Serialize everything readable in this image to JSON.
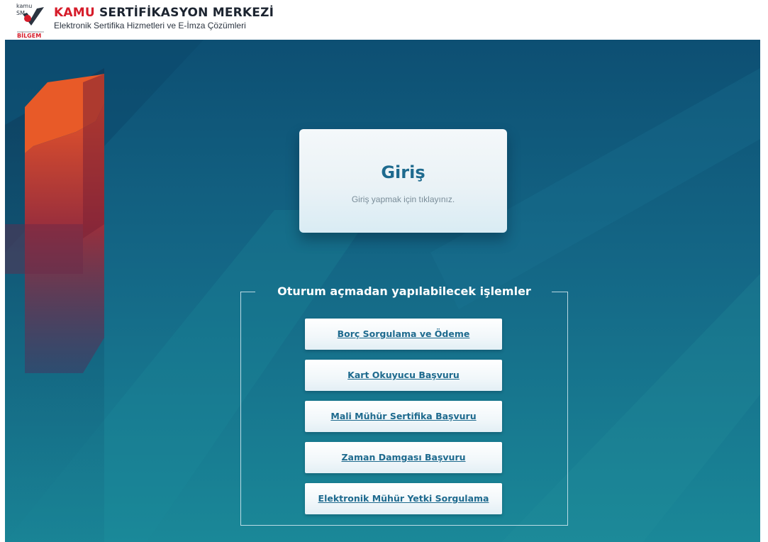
{
  "header": {
    "logo_text_top": "kamu",
    "logo_text_mid": "SM",
    "logo_text_bottom": "BİLGEM",
    "title_red": "KAMU",
    "title_dark": "SERTİFİKASYON MERKEZİ",
    "subtitle": "Elektronik Sertifika Hizmetleri ve E-İmza Çözümleri"
  },
  "login": {
    "title": "Giriş",
    "subtitle": "Giriş yapmak için tıklayınız."
  },
  "operations": {
    "heading": "Oturum açmadan yapılabilecek işlemler",
    "items": [
      {
        "label": "Borç Sorgulama ve Ödeme"
      },
      {
        "label": "Kart Okuyucu Başvuru"
      },
      {
        "label": "Mali Mühür Sertifika Başvuru"
      },
      {
        "label": "Zaman Damgası Başvuru"
      },
      {
        "label": "Elektronik Mühür Yetki Sorgulama"
      }
    ]
  },
  "colors": {
    "brand_red": "#d61c2a",
    "link_blue": "#1e6a8e",
    "background_top": "#0d4f73",
    "background_bottom": "#1a8898"
  }
}
